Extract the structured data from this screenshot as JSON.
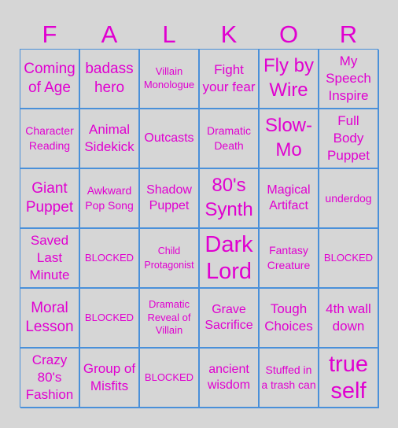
{
  "title_letters": [
    "F",
    "A",
    "L",
    "K",
    "O",
    "R"
  ],
  "colors": {
    "background": "#d6d6d6",
    "text": "#e000d0",
    "grid_lines": "#4a90d9"
  },
  "board": {
    "rows": [
      [
        "Coming of Age",
        "badass hero",
        "Villain Monologue",
        "Fight your fear",
        "Fly by Wire",
        "My Speech Inspire"
      ],
      [
        "Character Reading",
        "Animal Sidekick",
        "Outcasts",
        "Dramatic Death",
        "Slow-Mo",
        "Full Body Puppet"
      ],
      [
        "Giant Puppet",
        "Awkward Pop Song",
        "Shadow Puppet",
        "80's Synth",
        "Magical Artifact",
        "underdog"
      ],
      [
        "Saved Last Minute",
        "BLOCKED",
        "Child Protagonist",
        "Dark Lord",
        "Fantasy Creature",
        "BLOCKED"
      ],
      [
        "Moral Lesson",
        "BLOCKED",
        "Dramatic Reveal of Villain",
        "Grave Sacrifice",
        "Tough Choices",
        "4th wall down"
      ],
      [
        "Crazy 80's Fashion",
        "Group of Misfits",
        "BLOCKED",
        "ancient wisdom",
        "Stuffed in a trash can",
        "true self"
      ]
    ]
  }
}
